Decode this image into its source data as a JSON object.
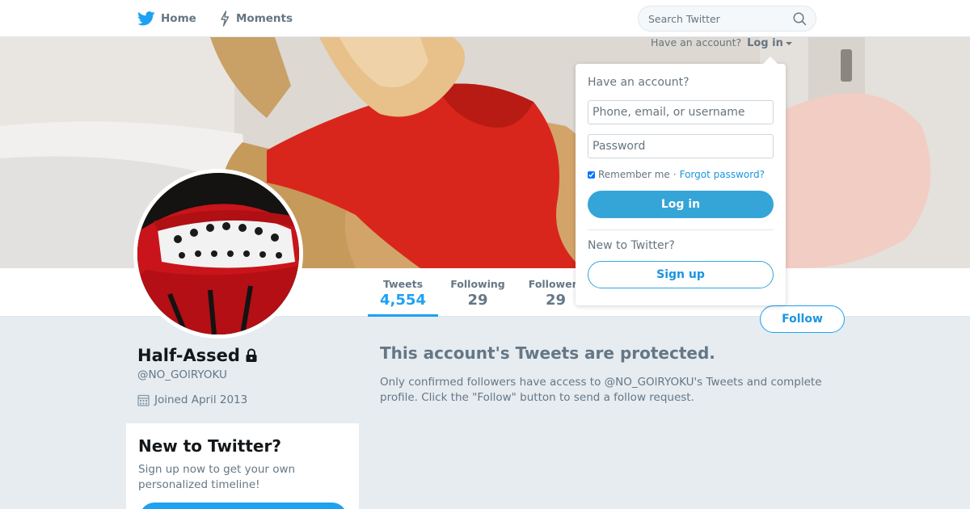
{
  "nav": {
    "home_label": "Home",
    "moments_label": "Moments",
    "search_placeholder": "Search Twitter"
  },
  "login_hint": {
    "text": "Have an account?",
    "link": "Log in"
  },
  "profile": {
    "display_name": "Half-Assed",
    "handle": "@NO_GOlRYOKU",
    "joined": "Joined April 2013",
    "protected": true
  },
  "stats": [
    {
      "label": "Tweets",
      "value": "4,554",
      "active": true
    },
    {
      "label": "Following",
      "value": "29",
      "active": false
    },
    {
      "label": "Followers",
      "value": "29",
      "active": false
    }
  ],
  "follow_button": "Follow",
  "protected_notice": {
    "title": "This account's Tweets are protected.",
    "description": "Only confirmed followers have access to @NO_GOlRYOKU's Tweets and complete profile. Click the \"Follow\" button to send a follow request."
  },
  "signup_card": {
    "title": "New to Twitter?",
    "text": "Sign up now to get your own personalized timeline!"
  },
  "login_dropdown": {
    "title": "Have an account?",
    "username_placeholder": "Phone, email, or username",
    "password_placeholder": "Password",
    "remember_label": "Remember me",
    "separator": "·",
    "forgot_label": "Forgot password?",
    "remember_checked": true,
    "login_button": "Log in",
    "new_title": "New to Twitter?",
    "signup_button": "Sign up"
  },
  "colors": {
    "accent": "#1da1f2",
    "login_button_bg": "#35a5d7",
    "page_bg": "#e6ecf0"
  },
  "icons": [
    "twitter-bird-icon",
    "lightning-icon",
    "search-icon",
    "lock-icon",
    "calendar-icon"
  ]
}
